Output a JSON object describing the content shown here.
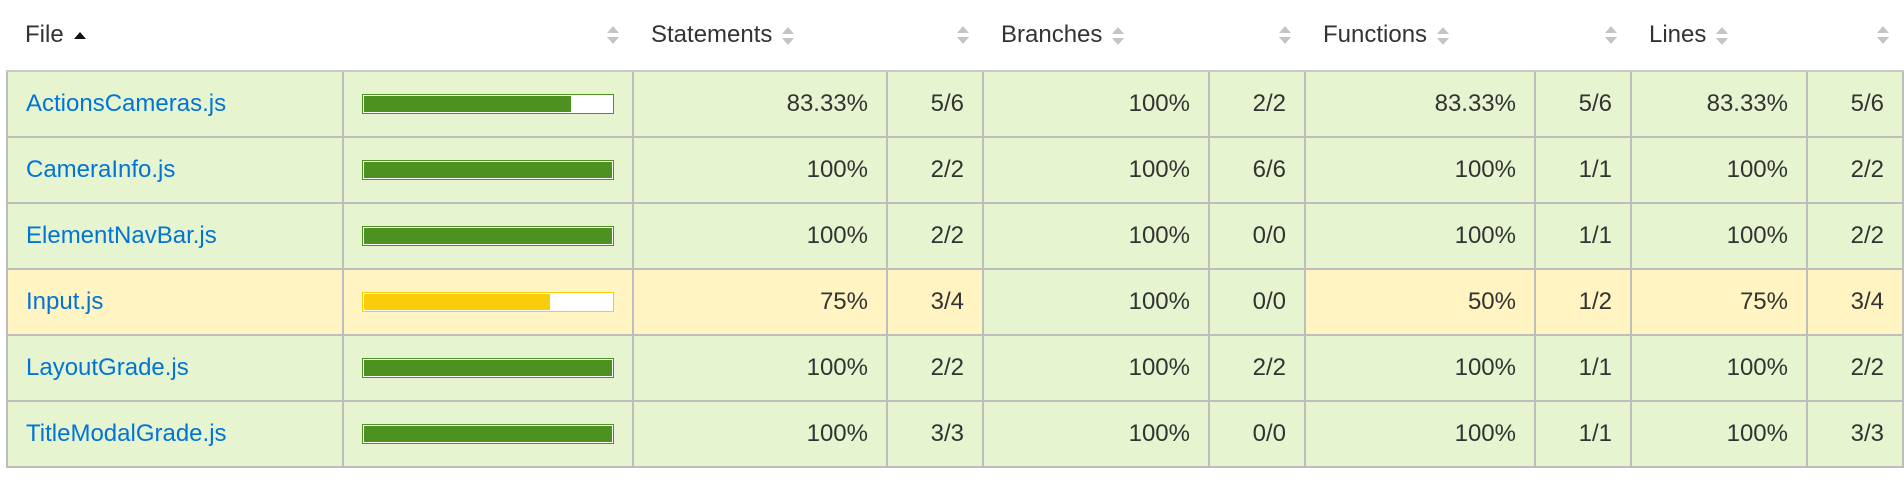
{
  "headers": {
    "file": "File",
    "statements": "Statements",
    "branches": "Branches",
    "functions": "Functions",
    "lines": "Lines"
  },
  "colors": {
    "high": "#e6f5d0",
    "medium": "#fff4c2",
    "high_bar": "#4d9221",
    "medium_bar": "#f9cd0b",
    "link": "#0074d9"
  },
  "rows": [
    {
      "file": "ActionsCameras.js",
      "level": "high",
      "coverage": 0.8333,
      "statements_pct": "83.33%",
      "statements": "5/6",
      "branches_pct": "100%",
      "branches": "2/2",
      "functions_pct": "83.33%",
      "functions": "5/6",
      "lines_pct": "83.33%",
      "lines": "5/6"
    },
    {
      "file": "CameraInfo.js",
      "level": "high",
      "coverage": 1.0,
      "statements_pct": "100%",
      "statements": "2/2",
      "branches_pct": "100%",
      "branches": "6/6",
      "functions_pct": "100%",
      "functions": "1/1",
      "lines_pct": "100%",
      "lines": "2/2"
    },
    {
      "file": "ElementNavBar.js",
      "level": "high",
      "coverage": 1.0,
      "statements_pct": "100%",
      "statements": "2/2",
      "branches_pct": "100%",
      "branches": "0/0",
      "functions_pct": "100%",
      "functions": "1/1",
      "lines_pct": "100%",
      "lines": "2/2"
    },
    {
      "file": "Input.js",
      "level": "medium",
      "coverage": 0.75,
      "statements_pct": "75%",
      "statements": "3/4",
      "branches_pct": "100%",
      "branches": "0/0",
      "functions_pct": "50%",
      "functions": "1/2",
      "lines_pct": "75%",
      "lines": "3/4",
      "branches_level": "high"
    },
    {
      "file": "LayoutGrade.js",
      "level": "high",
      "coverage": 1.0,
      "statements_pct": "100%",
      "statements": "2/2",
      "branches_pct": "100%",
      "branches": "2/2",
      "functions_pct": "100%",
      "functions": "1/1",
      "lines_pct": "100%",
      "lines": "2/2"
    },
    {
      "file": "TitleModalGrade.js",
      "level": "high",
      "coverage": 1.0,
      "statements_pct": "100%",
      "statements": "3/3",
      "branches_pct": "100%",
      "branches": "0/0",
      "functions_pct": "100%",
      "functions": "1/1",
      "lines_pct": "100%",
      "lines": "3/3"
    }
  ]
}
